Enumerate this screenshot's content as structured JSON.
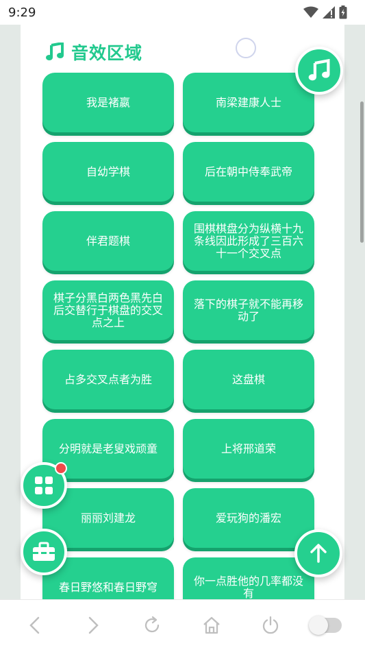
{
  "status_bar": {
    "time": "9:29"
  },
  "section": {
    "title": "音效区域"
  },
  "sound_buttons": [
    "我是褚嬴",
    "南梁建康人士",
    "自幼学棋",
    "后在朝中侍奉武帝",
    "伴君题棋",
    "围棋棋盘分为纵横十九条线因此形成了三百六十一个交叉点",
    "棋子分黑白两色黑先白后交替行于棋盘的交叉点之上",
    "落下的棋子就不能再移动了",
    "占多交叉点者为胜",
    "这盘棋",
    "分明就是老叟戏顽童",
    "上将邢道荣",
    "丽丽刘建龙",
    "爱玩狗的潘宏",
    "春日野悠和春日野穹",
    "你一点胜他的几率都没有"
  ],
  "fabs": {
    "music": "music-note-icon",
    "grid_menu": "grid-icon",
    "toolbox": "toolbox-icon",
    "scroll_top": "arrow-up-icon"
  },
  "bottom_nav": {
    "items": [
      "back-icon",
      "forward-icon",
      "refresh-icon",
      "home-icon",
      "power-icon",
      "toggle-switch"
    ]
  },
  "colors": {
    "accent": "#25d08f",
    "accent_dark": "#15a26d",
    "badge": "#f04a4a",
    "background": "#e3e9e6"
  }
}
